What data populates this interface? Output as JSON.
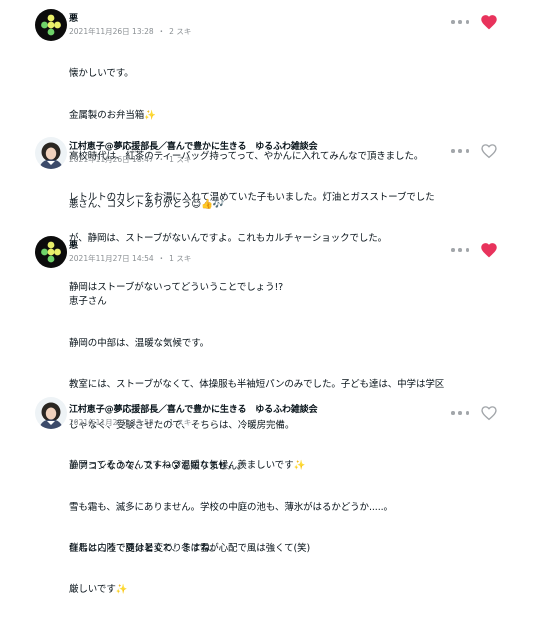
{
  "colors": {
    "liked_heart": "#e8335c",
    "unliked_heart": "#a2a6aa",
    "meta_text": "#8a8f93"
  },
  "comments": [
    {
      "author": "悪",
      "date": "2021年11月26日 13:28",
      "likes": "2 スキ",
      "liked": true,
      "lines": [
        "懐かしいです。",
        "金属製のお弁当箱✨",
        "高校時代は、紅茶のティーバッグ持ってって、やかんに入れてみんなで頂きました。",
        "レトルトのカレーをお湯に入れて温めていた子もいました。灯油とガスストーブでした",
        "が、静岡は、ストーブがないんですよ。これもカルチャーショックでした。"
      ]
    },
    {
      "author": "江村恵子@夢応援部長／喜んで豊かに生きる　ゆるふわ雑談会",
      "date": "2021年11月26日 18:47",
      "likes": "1 スキ",
      "liked": false,
      "lines": [
        "悪さん、コメントありがとう😊👍🎶",
        "",
        "静岡はストーブがないってどういうことでしょう!?"
      ]
    },
    {
      "author": "悪",
      "date": "2021年11月27日 14:54",
      "likes": "1 スキ",
      "liked": true,
      "lines": [
        "恵子さん",
        "静岡の中部は、温暖な気候です。",
        "教室には、ストーブがなくて、体操服も半袖短パンのみでした。子ども達は、中学は学区",
        "じゃなく、受験させたので、そちらは、冷暖房完備。",
        "エアコンなので、ストーブを知りません。",
        "雪も霜も、滅多にありません。学校の中庭の池も、薄氷がはるかどうか.....。",
        "住むところで随分と変わりますね。"
      ]
    },
    {
      "author": "江村恵子@夢応援部長／喜んで豊かに生きる　ゆるふわ雑談会",
      "date": "2021年11月27日 15:58",
      "likes": "1 スキ",
      "liked": false,
      "lines": [
        "静岡ってそうなんですね😮温暖な気候、羨ましいです✨",
        "",
        "群馬は内陸で夏は暑くて、冬は雪が心配で風は強くて(笑)",
        "厳しいです✨"
      ]
    }
  ]
}
